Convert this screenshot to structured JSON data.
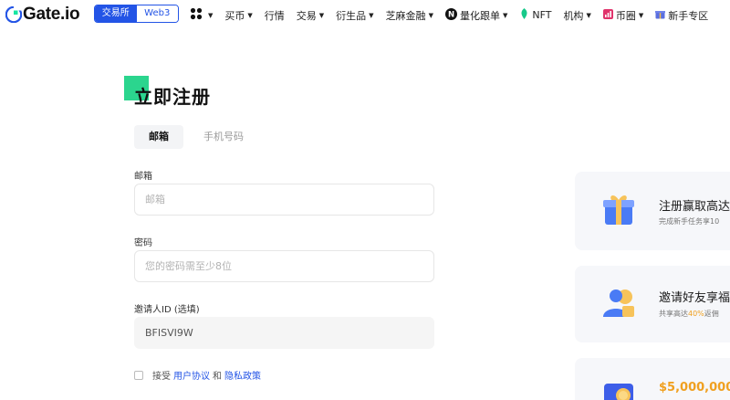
{
  "nav": {
    "logo_text": "Gate.io",
    "toggle": {
      "active": "交易所",
      "inactive": "Web3"
    },
    "items": [
      {
        "label": "",
        "icon": "grid-icon",
        "caret": true
      },
      {
        "label": "买币",
        "caret": true
      },
      {
        "label": "行情",
        "caret": false
      },
      {
        "label": "交易",
        "caret": true
      },
      {
        "label": "衍生品",
        "caret": true
      },
      {
        "label": "芝麻金融",
        "caret": true
      },
      {
        "label": "量化跟单",
        "icon": "n-badge-icon",
        "caret": true
      },
      {
        "label": "NFT",
        "icon": "leaf-icon",
        "caret": false
      },
      {
        "label": "机构",
        "caret": true
      },
      {
        "label": "币圈",
        "icon": "chart-icon",
        "caret": true
      },
      {
        "label": "新手专区",
        "icon": "gift-icon",
        "caret": false
      }
    ]
  },
  "form": {
    "title": "立即注册",
    "tabs": {
      "email": "邮箱",
      "phone": "手机号码"
    },
    "email_label": "邮箱",
    "email_placeholder": "邮箱",
    "password_label": "密码",
    "password_placeholder": "您的密码需至少8位",
    "referral_label": "邀请人ID (选填)",
    "referral_value": "BFISVI9W",
    "agree": {
      "prefix": "接受",
      "terms": "用户协议",
      "and": "和",
      "privacy": "隐私政策"
    }
  },
  "cards": [
    {
      "title": "注册赢取高达",
      "sub_pre": "完成新手任务享10",
      "sub_hl": "",
      "sub_post": ""
    },
    {
      "title": "邀请好友享福",
      "sub_pre": "共享高达",
      "sub_hl": "40%",
      "sub_post": "返佣"
    },
    {
      "title": "$5,000,000+",
      "sub_pre": "",
      "sub_hl": "",
      "sub_post": ""
    }
  ],
  "colors": {
    "brand_blue": "#2354e6",
    "accent_green": "#2bd58e",
    "gold": "#f0a020"
  }
}
